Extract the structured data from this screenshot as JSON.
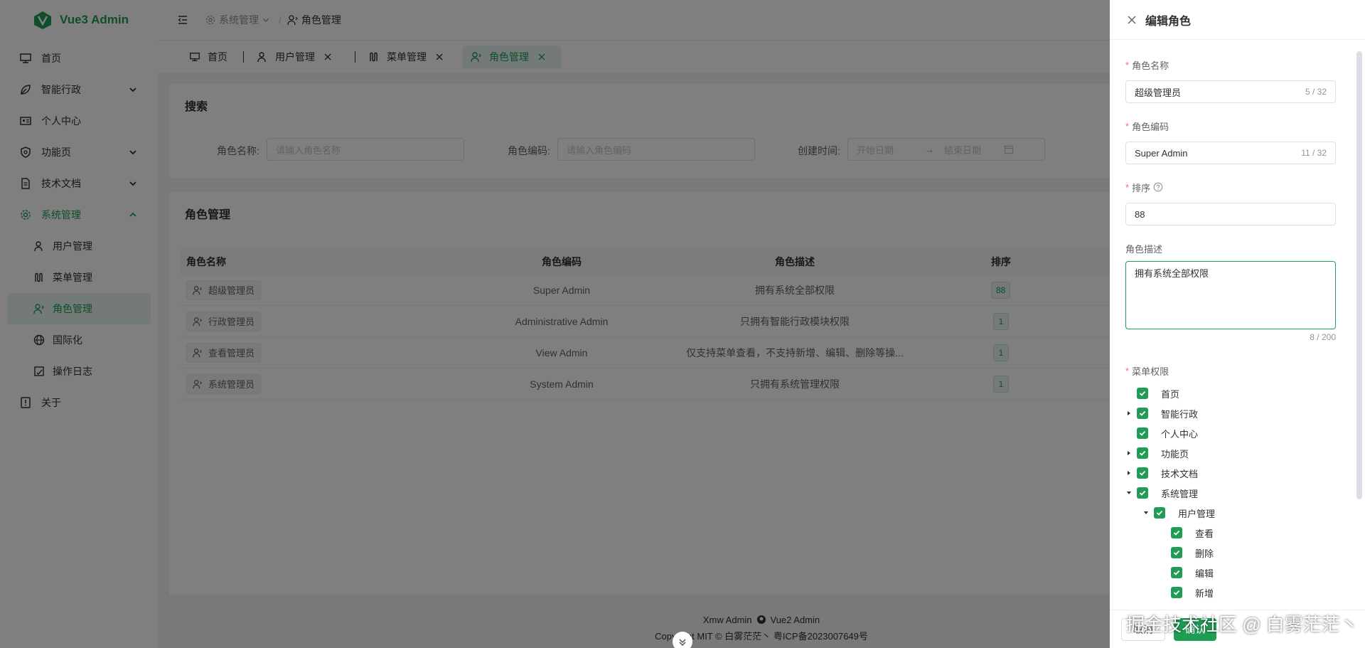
{
  "app": {
    "title": "Vue3 Admin",
    "brand_color": "#1f9d55"
  },
  "sidebar": {
    "items": [
      {
        "label": "首页",
        "icon": "monitor-icon"
      },
      {
        "label": "智能行政",
        "icon": "leaf-icon"
      },
      {
        "label": "个人中心",
        "icon": "id-card-icon"
      },
      {
        "label": "功能页",
        "icon": "shield-icon"
      },
      {
        "label": "技术文档",
        "icon": "document-icon"
      },
      {
        "label": "系统管理",
        "icon": "gear-icon"
      },
      {
        "label": "关于",
        "icon": "info-icon"
      }
    ],
    "sub_items": [
      {
        "label": "用户管理",
        "icon": "user-icon"
      },
      {
        "label": "菜单管理",
        "icon": "menu-icon"
      },
      {
        "label": "角色管理",
        "icon": "role-icon"
      },
      {
        "label": "国际化",
        "icon": "globe-icon"
      },
      {
        "label": "操作日志",
        "icon": "log-icon"
      }
    ]
  },
  "header": {
    "breadcrumb": [
      "系统管理",
      "角色管理"
    ],
    "separator": "/"
  },
  "tabs": [
    {
      "label": "首页"
    },
    {
      "label": "用户管理"
    },
    {
      "label": "菜单管理"
    },
    {
      "label": "角色管理"
    }
  ],
  "search": {
    "title": "搜索",
    "role_name_label": "角色名称:",
    "role_name_placeholder": "请输入角色名称",
    "role_code_label": "角色编码:",
    "role_code_placeholder": "请输入角色编码",
    "created_label": "创建时间:",
    "start_placeholder": "开始日期",
    "range_sep": "→",
    "end_placeholder": "结束日期"
  },
  "table": {
    "title": "角色管理",
    "columns": [
      "角色名称",
      "角色编码",
      "角色描述",
      "排序"
    ],
    "rows": [
      {
        "name": "超级管理员",
        "code": "Super Admin",
        "desc": "拥有系统全部权限",
        "sort": "88"
      },
      {
        "name": "行政管理员",
        "code": "Administrative Admin",
        "desc": "只拥有智能行政模块权限",
        "sort": "1"
      },
      {
        "name": "查看管理员",
        "code": "View Admin",
        "desc": "仅支持菜单查看，不支持新增、编辑、删除等操...",
        "sort": "1"
      },
      {
        "name": "系统管理员",
        "code": "System Admin",
        "desc": "只拥有系统管理权限",
        "sort": "1"
      }
    ]
  },
  "footer": {
    "line1_left": "Xmw Admin",
    "line1_right": "Vue2 Admin",
    "line2": "Copyright MIT ©  白雾茫茫丶   粤ICP备2023007649号"
  },
  "drawer": {
    "title": "编辑角色",
    "role_name": {
      "label": "角色名称",
      "value": "超级管理员",
      "count": "5 / 32"
    },
    "role_code": {
      "label": "角色编码",
      "value": "Super Admin",
      "count": "11 / 32"
    },
    "sort": {
      "label": "排序",
      "value": "88"
    },
    "desc": {
      "label": "角色描述",
      "value": "拥有系统全部权限",
      "count": "8 / 200"
    },
    "perm_label": "菜单权限",
    "tree": [
      {
        "label": "首页"
      },
      {
        "label": "智能行政"
      },
      {
        "label": "个人中心"
      },
      {
        "label": "功能页"
      },
      {
        "label": "技术文档"
      },
      {
        "label": "系统管理"
      },
      {
        "label": "用户管理"
      },
      {
        "label": "查看"
      },
      {
        "label": "删除"
      },
      {
        "label": "编辑"
      },
      {
        "label": "新增"
      }
    ],
    "cancel_label": "取消",
    "ok_label": "确认"
  },
  "watermark": "掘金技术社区 @ 白雾茫茫丶"
}
